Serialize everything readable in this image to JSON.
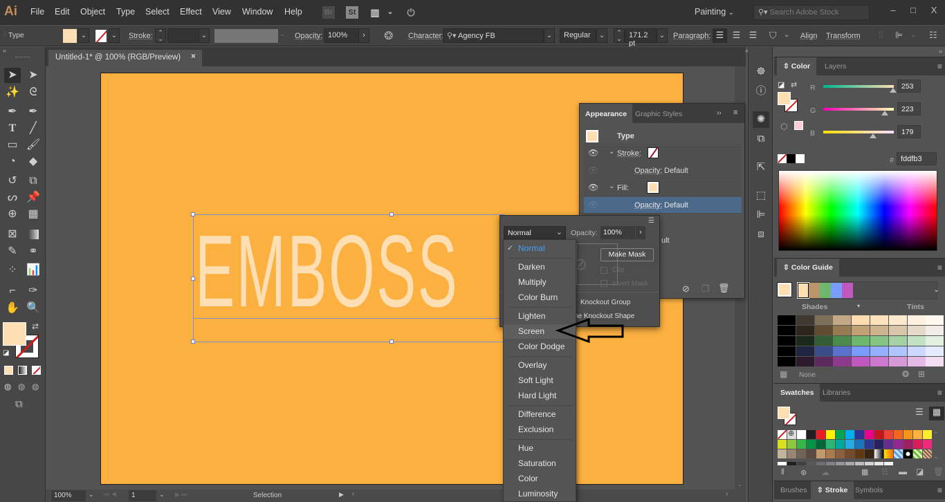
{
  "app": {
    "logo": "Ai"
  },
  "menubar": {
    "items": [
      "File",
      "Edit",
      "Object",
      "Type",
      "Select",
      "Effect",
      "View",
      "Window",
      "Help"
    ],
    "icons": [
      "bridge-icon",
      "stock-icon",
      "arrange-documents-icon",
      "gpu-performance-icon"
    ],
    "bridge_label": "Br",
    "stock_label": "St",
    "workspace": "Painting",
    "search_placeholder": "Search Adobe Stock",
    "window_controls": [
      "–",
      "□",
      "X"
    ]
  },
  "controlbar": {
    "selection_type": "Type",
    "stroke_label": "Stroke:",
    "opacity_label": "Opacity:",
    "opacity_value": "100%",
    "character_label": "Character:",
    "font_family": "Agency FB",
    "font_style": "Regular",
    "font_size": "171.2 pt",
    "paragraph_label": "Paragraph:",
    "align_label": "Align",
    "transform_label": "Transform"
  },
  "document": {
    "tab_title": "Untitled-1* @ 100% (RGB/Preview)",
    "artboard_color": "#fbb040",
    "text_content": "EMBOSS",
    "text_color": "#fddfb3"
  },
  "statusbar": {
    "zoom": "100%",
    "artboard_number": "1",
    "tool_name": "Selection"
  },
  "appearance_panel": {
    "tabs": [
      "Appearance",
      "Graphic Styles"
    ],
    "object_type": "Type",
    "rows": [
      {
        "label": "Stroke:",
        "kind": "stroke"
      },
      {
        "label": "Opacity:",
        "value": "Default"
      },
      {
        "label": "Fill:",
        "kind": "fill"
      },
      {
        "label": "Opacity:",
        "value": "Default",
        "selected": true
      }
    ],
    "partial_text": "ult"
  },
  "transparency_panel": {
    "blend_mode": "Normal",
    "opacity_label": "Opacity:",
    "opacity_value": "100%",
    "make_mask": "Make Mask",
    "clip": "Clip",
    "invert_mask": "Invert Mask",
    "knockout_group": "Knockout Group",
    "knockout_shape": "ne Knockout Shape"
  },
  "blend_dropdown": {
    "selected": "Normal",
    "highlighted": "Screen",
    "groups": [
      [
        "Normal"
      ],
      [
        "Darken",
        "Multiply",
        "Color Burn"
      ],
      [
        "Lighten",
        "Screen",
        "Color Dodge"
      ],
      [
        "Overlay",
        "Soft Light",
        "Hard Light"
      ],
      [
        "Difference",
        "Exclusion"
      ],
      [
        "Hue",
        "Saturation",
        "Color",
        "Luminosity"
      ]
    ]
  },
  "color_panel": {
    "tabs": [
      "Color",
      "Layers"
    ],
    "channels": [
      {
        "name": "R",
        "value": "253",
        "fraction": 0.992
      },
      {
        "name": "G",
        "value": "223",
        "fraction": 0.875
      },
      {
        "name": "B",
        "value": "179",
        "fraction": 0.702
      }
    ],
    "hex_label": "#",
    "hex_value": "fddfb3",
    "fill_color": "#fddfb3"
  },
  "color_guide_panel": {
    "title": "Color Guide",
    "harmony": [
      "#fddfb3",
      "#b8956a",
      "#6cb86c",
      "#7a9cff",
      "#c058c0"
    ],
    "shades_label": "Shades",
    "tints_label": "Tints",
    "footer_label": "None",
    "grid": [
      [
        "#000000",
        "#3f392f",
        "#7d7058",
        "#c2a887",
        "#fedcb0",
        "#fde2bd",
        "#fde9cd",
        "#fef1df",
        "#fef8ef"
      ],
      [
        "#000000",
        "#2c261d",
        "#5f4c31",
        "#977b52",
        "#c2a174",
        "#cdb38e",
        "#d8c5aa",
        "#e5d9c8",
        "#f1ece5"
      ],
      [
        "#000000",
        "#1c2a1c",
        "#355d35",
        "#4d8a4d",
        "#6cb86c",
        "#87c587",
        "#a4d2a4",
        "#c3e1c3",
        "#e1f0e1"
      ],
      [
        "#000000",
        "#1e2540",
        "#3a4c8a",
        "#5a72cc",
        "#7a9cff",
        "#94b0ff",
        "#b0c4ff",
        "#ccd8ff",
        "#e6ecff"
      ],
      [
        "#000000",
        "#2c1a2c",
        "#5c2a5c",
        "#8c3a8c",
        "#c058c0",
        "#cc78cc",
        "#d899d8",
        "#e5bbe5",
        "#f2ddf2"
      ]
    ]
  },
  "swatches_panel": {
    "tabs": [
      "Swatches",
      "Libraries"
    ],
    "rows": [
      [
        "none",
        "registration",
        "#ffffff",
        "#231f20",
        "#ed1c24",
        "#fff200",
        "#00a651",
        "#00aeef",
        "#2e3192",
        "#ec008c",
        "#c4161c",
        "#ef4136",
        "#f26522",
        "#f7941d",
        "#fbb040",
        "#f9ed32"
      ],
      [
        "#d7df23",
        "#8dc63f",
        "#39b54a",
        "#009444",
        "#006838",
        "#2bb673",
        "#00a79d",
        "#27aae1",
        "#1c75bc",
        "#2b3990",
        "#262262",
        "#662d91",
        "#92278f",
        "#9e1f63",
        "#da1c5c",
        "#ee2a7b"
      ],
      [
        "#c2b59b",
        "#998675",
        "#736357",
        "#594a42",
        "#c49a6c",
        "#a97c50",
        "#8b5e3c",
        "#754c29",
        "#603913",
        "#3c2415",
        "gradient-bw",
        "gradient-orange",
        "pattern-blue",
        "pattern-dots",
        "pattern-green",
        "pattern-brown"
      ],
      [
        "#ffffff",
        "#231f20",
        "#414042",
        "#58595b",
        "#6d6e71",
        "#808285",
        "#939598",
        "#a7a9ac",
        "#bcbec0",
        "#d1d3d4",
        "#e6e7e8",
        "#f1f2f2"
      ]
    ]
  },
  "bottom_panel": {
    "tabs": [
      "Brushes",
      "Stroke",
      "Symbols"
    ],
    "active": "Stroke"
  },
  "toolbar": {
    "fill_color": "#fddfb3",
    "tools": [
      "selection",
      "direct-selection",
      "magic-wand",
      "lasso",
      "pen",
      "curvature",
      "type",
      "line-segment",
      "rectangle",
      "paintbrush",
      "shaper",
      "eraser",
      "rotate",
      "scale",
      "warp",
      "puppet-warp",
      "shape-builder",
      "perspective-grid",
      "mesh",
      "gradient",
      "eyedropper",
      "blend",
      "symbol-sprayer",
      "column-graph",
      "artboard",
      "slice",
      "hand",
      "zoom"
    ]
  }
}
